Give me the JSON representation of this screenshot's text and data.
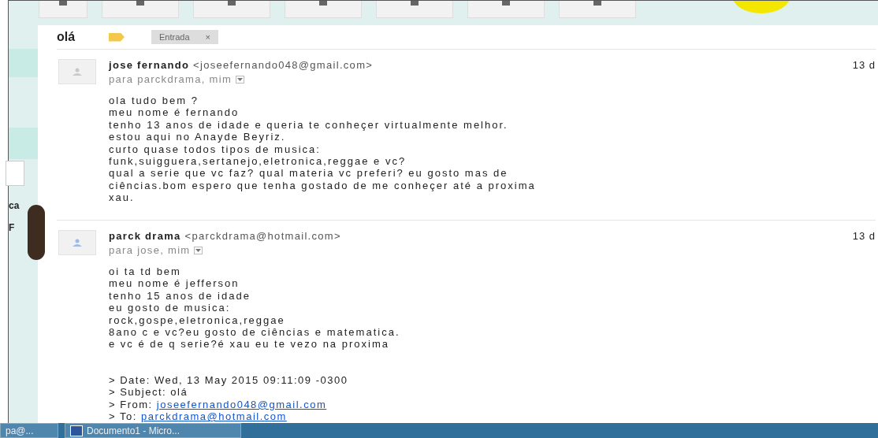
{
  "subject": "olá",
  "label_chip": {
    "text": "Entrada",
    "close": "×"
  },
  "sidebar": {
    "fragments": [
      "ca",
      "F"
    ]
  },
  "messages": [
    {
      "sender": "jose fernando",
      "email": "<joseefernando048@gmail.com>",
      "recipients": "para parckdrama, mim",
      "date": "13 d",
      "body": "ola tudo bem ?\nmeu nome é fernando\ntenho 13 anos de idade e queria te conheçer virtualmente melhor.\nestou aqui no Anayde Beyriz.\ncurto quase todos tipos de musica:\nfunk,suigguera,sertanejo,eletronica,reggae e vc?\nqual a  serie que vc faz? qual materia vc preferi? eu gosto mas de\nciências.bom espero que tenha gostado de me conheçer até a proxima\nxau."
    },
    {
      "sender": "parck drama",
      "email": "<parckdrama@hotmail.com>",
      "recipients": "para jose, mim",
      "date": "13 d",
      "body": "oi ta td bem\nmeu nome é jefferson\ntenho 15 anos de idade\neu gosto de musica:\nrock,gospe,eletronica,reggae\n8ano c e vc?eu gosto de ciências e matematica.\ne vc é de q serie?é xau eu te vezo na proxima",
      "quoted": [
        {
          "label": "> Date: Wed, 13 May 2015 09:11:09 -0300"
        },
        {
          "label": "> Subject: olá"
        },
        {
          "label": "> From: ",
          "link": "joseefernando048@gmail.com"
        },
        {
          "label": "> To: ",
          "link": "parckdrama@hotmail.com"
        }
      ]
    }
  ],
  "taskbar": [
    {
      "label": "pa@...",
      "kind": "plain"
    },
    {
      "label": "Documento1 - Micro...",
      "kind": "word"
    }
  ]
}
